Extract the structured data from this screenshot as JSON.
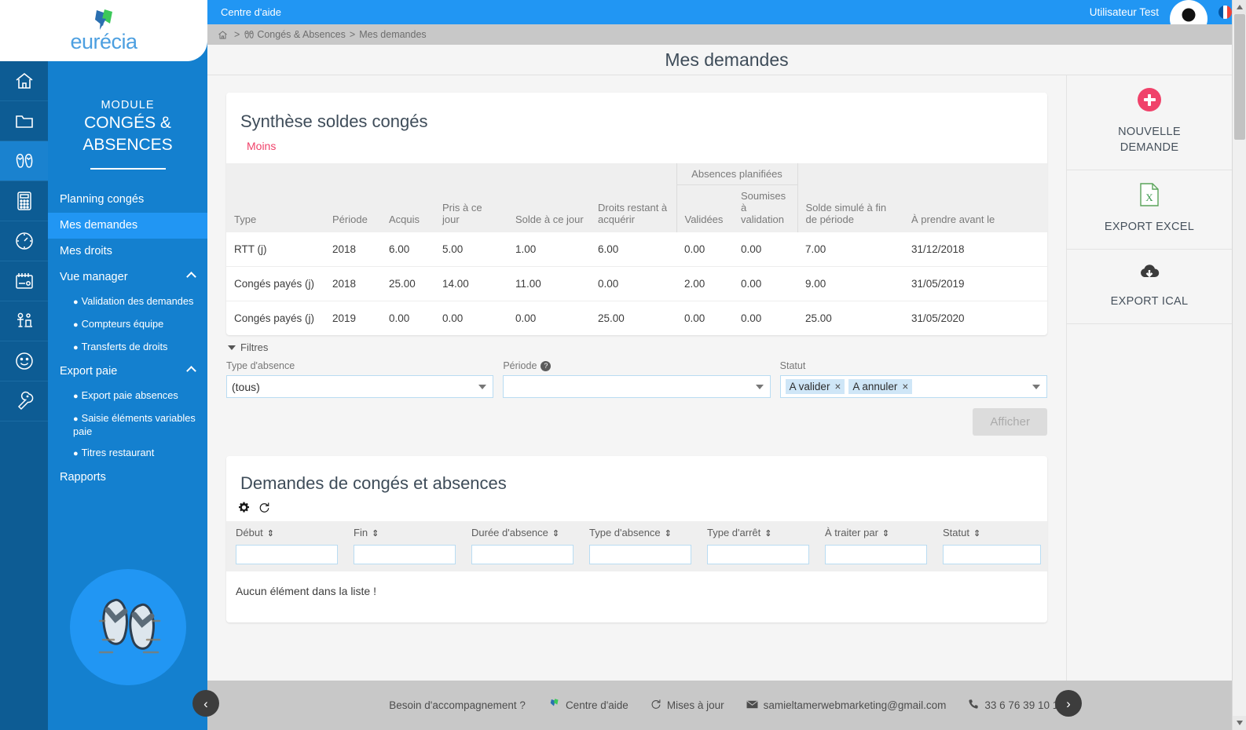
{
  "brand": {
    "name": "eurécia",
    "logo_icon": "eurecia-leaf-logo"
  },
  "topbar": {
    "help_center": "Centre d'aide",
    "user_name": "Utilisateur  Test",
    "avatar_icon": "user-avatar-icon",
    "flag_icon": "french-flag-icon"
  },
  "breadcrumb": {
    "home_icon": "home-icon",
    "sep1": ">",
    "module_icon": "flipflop-icon",
    "module": "Congés & Absences",
    "sep2": ">",
    "page": "Mes demandes"
  },
  "page": {
    "title": "Mes demandes"
  },
  "rail": [
    {
      "name": "home-icon",
      "active": false
    },
    {
      "name": "folder-icon",
      "active": false
    },
    {
      "name": "flipflop-icon",
      "active": true
    },
    {
      "name": "calculator-icon",
      "active": false
    },
    {
      "name": "gauge-icon",
      "active": false
    },
    {
      "name": "calendar-icon",
      "active": false
    },
    {
      "name": "people-icon",
      "active": false
    },
    {
      "name": "smiley-icon",
      "active": false
    },
    {
      "name": "wrench-icon",
      "active": false
    }
  ],
  "sidebar": {
    "module_small": "MODULE",
    "module_line1": "CONGÉS &",
    "module_line2": "ABSENCES",
    "items": [
      {
        "label": "Planning congés",
        "type": "item",
        "active": false,
        "expandable": false
      },
      {
        "label": "Mes demandes",
        "type": "item",
        "active": true,
        "expandable": false
      },
      {
        "label": "Mes droits",
        "type": "item",
        "active": false,
        "expandable": false
      },
      {
        "label": "Vue manager",
        "type": "item",
        "active": false,
        "expandable": true
      },
      {
        "label": "Validation des demandes",
        "type": "sub"
      },
      {
        "label": "Compteurs équipe",
        "type": "sub"
      },
      {
        "label": "Transferts de droits",
        "type": "sub"
      },
      {
        "label": "Export paie",
        "type": "item",
        "active": false,
        "expandable": true
      },
      {
        "label": "Export paie absences",
        "type": "sub"
      },
      {
        "label": "Saisie éléments variables paie",
        "type": "sub"
      },
      {
        "label": "Titres restaurant",
        "type": "sub"
      },
      {
        "label": "Rapports",
        "type": "item",
        "active": false,
        "expandable": false
      }
    ],
    "illustration_icon": "flipflop-illustration"
  },
  "synthese": {
    "title": "Synthèse soldes congés",
    "toggle_label": "Moins",
    "group_header": "Absences planifiées",
    "columns": [
      "Type",
      "Période",
      "Acquis",
      "Pris à ce jour",
      "Solde à ce jour",
      "Droits restant à acquérir",
      "Validées",
      "Soumises à validation",
      "Solde simulé à fin de période",
      "À prendre avant le"
    ],
    "rows": [
      {
        "type": "RTT (j)",
        "periode": "2018",
        "acquis": "6.00",
        "pris": "5.00",
        "solde": "1.00",
        "droits_restant": "6.00",
        "validees": "0.00",
        "soumises": "0.00",
        "solde_simule": "7.00",
        "a_prendre_avant": "31/12/2018"
      },
      {
        "type": "Congés payés (j)",
        "periode": "2018",
        "acquis": "25.00",
        "pris": "14.00",
        "solde": "11.00",
        "droits_restant": "0.00",
        "validees": "2.00",
        "soumises": "0.00",
        "solde_simule": "9.00",
        "a_prendre_avant": "31/05/2019"
      },
      {
        "type": "Congés payés (j)",
        "periode": "2019",
        "acquis": "0.00",
        "pris": "0.00",
        "solde": "0.00",
        "droits_restant": "25.00",
        "validees": "0.00",
        "soumises": "0.00",
        "solde_simule": "25.00",
        "a_prendre_avant": "31/05/2020"
      }
    ]
  },
  "filters": {
    "toggle_label": "Filtres",
    "type_absence": {
      "label": "Type d'absence",
      "value": "(tous)"
    },
    "periode": {
      "label": "Période",
      "value": "",
      "help_icon": "question-mark-icon"
    },
    "statut": {
      "label": "Statut",
      "tags": [
        "A valider",
        "A annuler"
      ]
    },
    "submit_label": "Afficher"
  },
  "demandes": {
    "title": "Demandes de congés et absences",
    "gear_icon": "gear-icon",
    "refresh_icon": "refresh-icon",
    "columns": [
      "Début",
      "Fin",
      "Durée d'absence",
      "Type d'absence",
      "Type d'arrêt",
      "À traiter par",
      "Statut"
    ],
    "filter_values": [
      "",
      "",
      "",
      "",
      "",
      "",
      ""
    ],
    "empty_message": "Aucun élément dans la liste !"
  },
  "actions": [
    {
      "label_line1": "NOUVELLE",
      "label_line2": "DEMANDE",
      "icon": "plus-circle-icon"
    },
    {
      "label_line1": "EXPORT EXCEL",
      "label_line2": "",
      "icon": "excel-file-icon"
    },
    {
      "label_line1": "EXPORT ICAL",
      "label_line2": "",
      "icon": "cloud-download-icon"
    }
  ],
  "footer": {
    "question": "Besoin d'accompagnement ?",
    "help_center": "Centre d'aide",
    "updates": "Mises à jour",
    "email": "samieltamerwebmarketing@gmail.com",
    "phone": "33 6 76 39 10 14",
    "leaf_icon": "eurecia-leaf-icon",
    "updates_icon": "refresh-icon",
    "mail_icon": "envelope-icon",
    "phone_icon": "phone-icon",
    "prev_icon": "chevron-left-icon",
    "next_icon": "chevron-right-icon"
  },
  "colors": {
    "brand_blue": "#1480cf",
    "topbar_blue": "#2196f3",
    "accent_pink": "#f0426a",
    "positive_green": "#1f9d55"
  }
}
